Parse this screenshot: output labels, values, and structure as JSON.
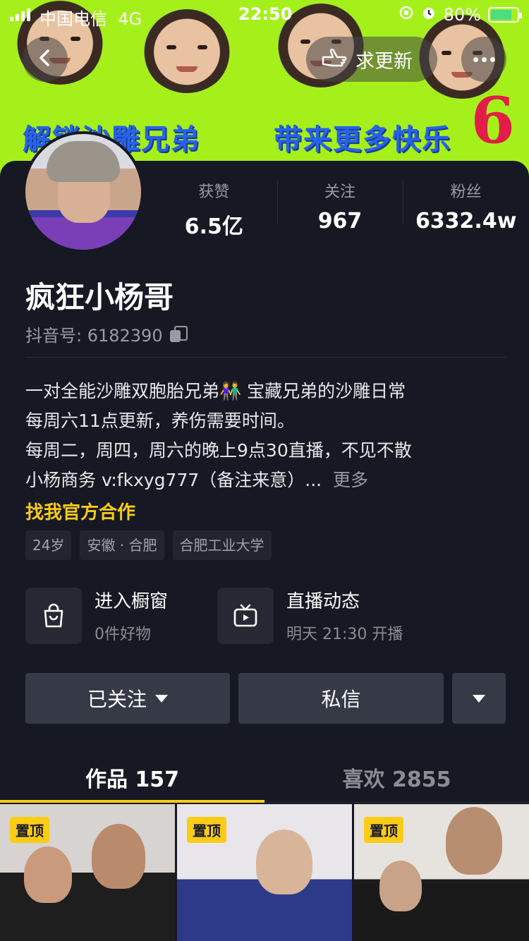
{
  "status_bar": {
    "carrier": "中国电信",
    "network": "4G",
    "time": "22:50",
    "battery": "80%",
    "battery_level": 0.8
  },
  "banner": {
    "text_left": "解锁沙雕兄弟",
    "text_right": "带来更多快乐",
    "mark": "6"
  },
  "header": {
    "update_label": "求更新"
  },
  "profile": {
    "name": "疯狂小杨哥",
    "douyin_id": "抖音号: 6182390",
    "stats": [
      {
        "label": "获赞",
        "value": "6.5亿"
      },
      {
        "label": "关注",
        "value": "967"
      },
      {
        "label": "粉丝",
        "value": "6332.4w"
      }
    ],
    "bio": [
      "一对全能沙雕双胞胎兄弟👫 宝藏兄弟的沙雕日常",
      "每周六11点更新，养伤需要时间。",
      "每周二，周四，周六的晚上9点30直播，不见不散",
      "小杨商务 v:fkxyg777（备注来意）..."
    ],
    "bio_more": "更多",
    "collab": "找我官方合作",
    "tags": [
      "24岁",
      "安徽 · 合肥",
      "合肥工业大学"
    ]
  },
  "cards": [
    {
      "title": "进入橱窗",
      "sub": "0件好物",
      "icon": "shopping-bag-icon"
    },
    {
      "title": "直播动态",
      "sub": "明天 21:30 开播",
      "icon": "tv-icon"
    }
  ],
  "actions": {
    "follow": "已关注",
    "message": "私信"
  },
  "tabs": [
    {
      "label": "作品 157"
    },
    {
      "label": "喜欢 2855"
    }
  ],
  "grid": {
    "pin_label": "置顶"
  },
  "colors": {
    "accent": "#facc15",
    "background": "#161823",
    "banner": "#a5f01a"
  }
}
